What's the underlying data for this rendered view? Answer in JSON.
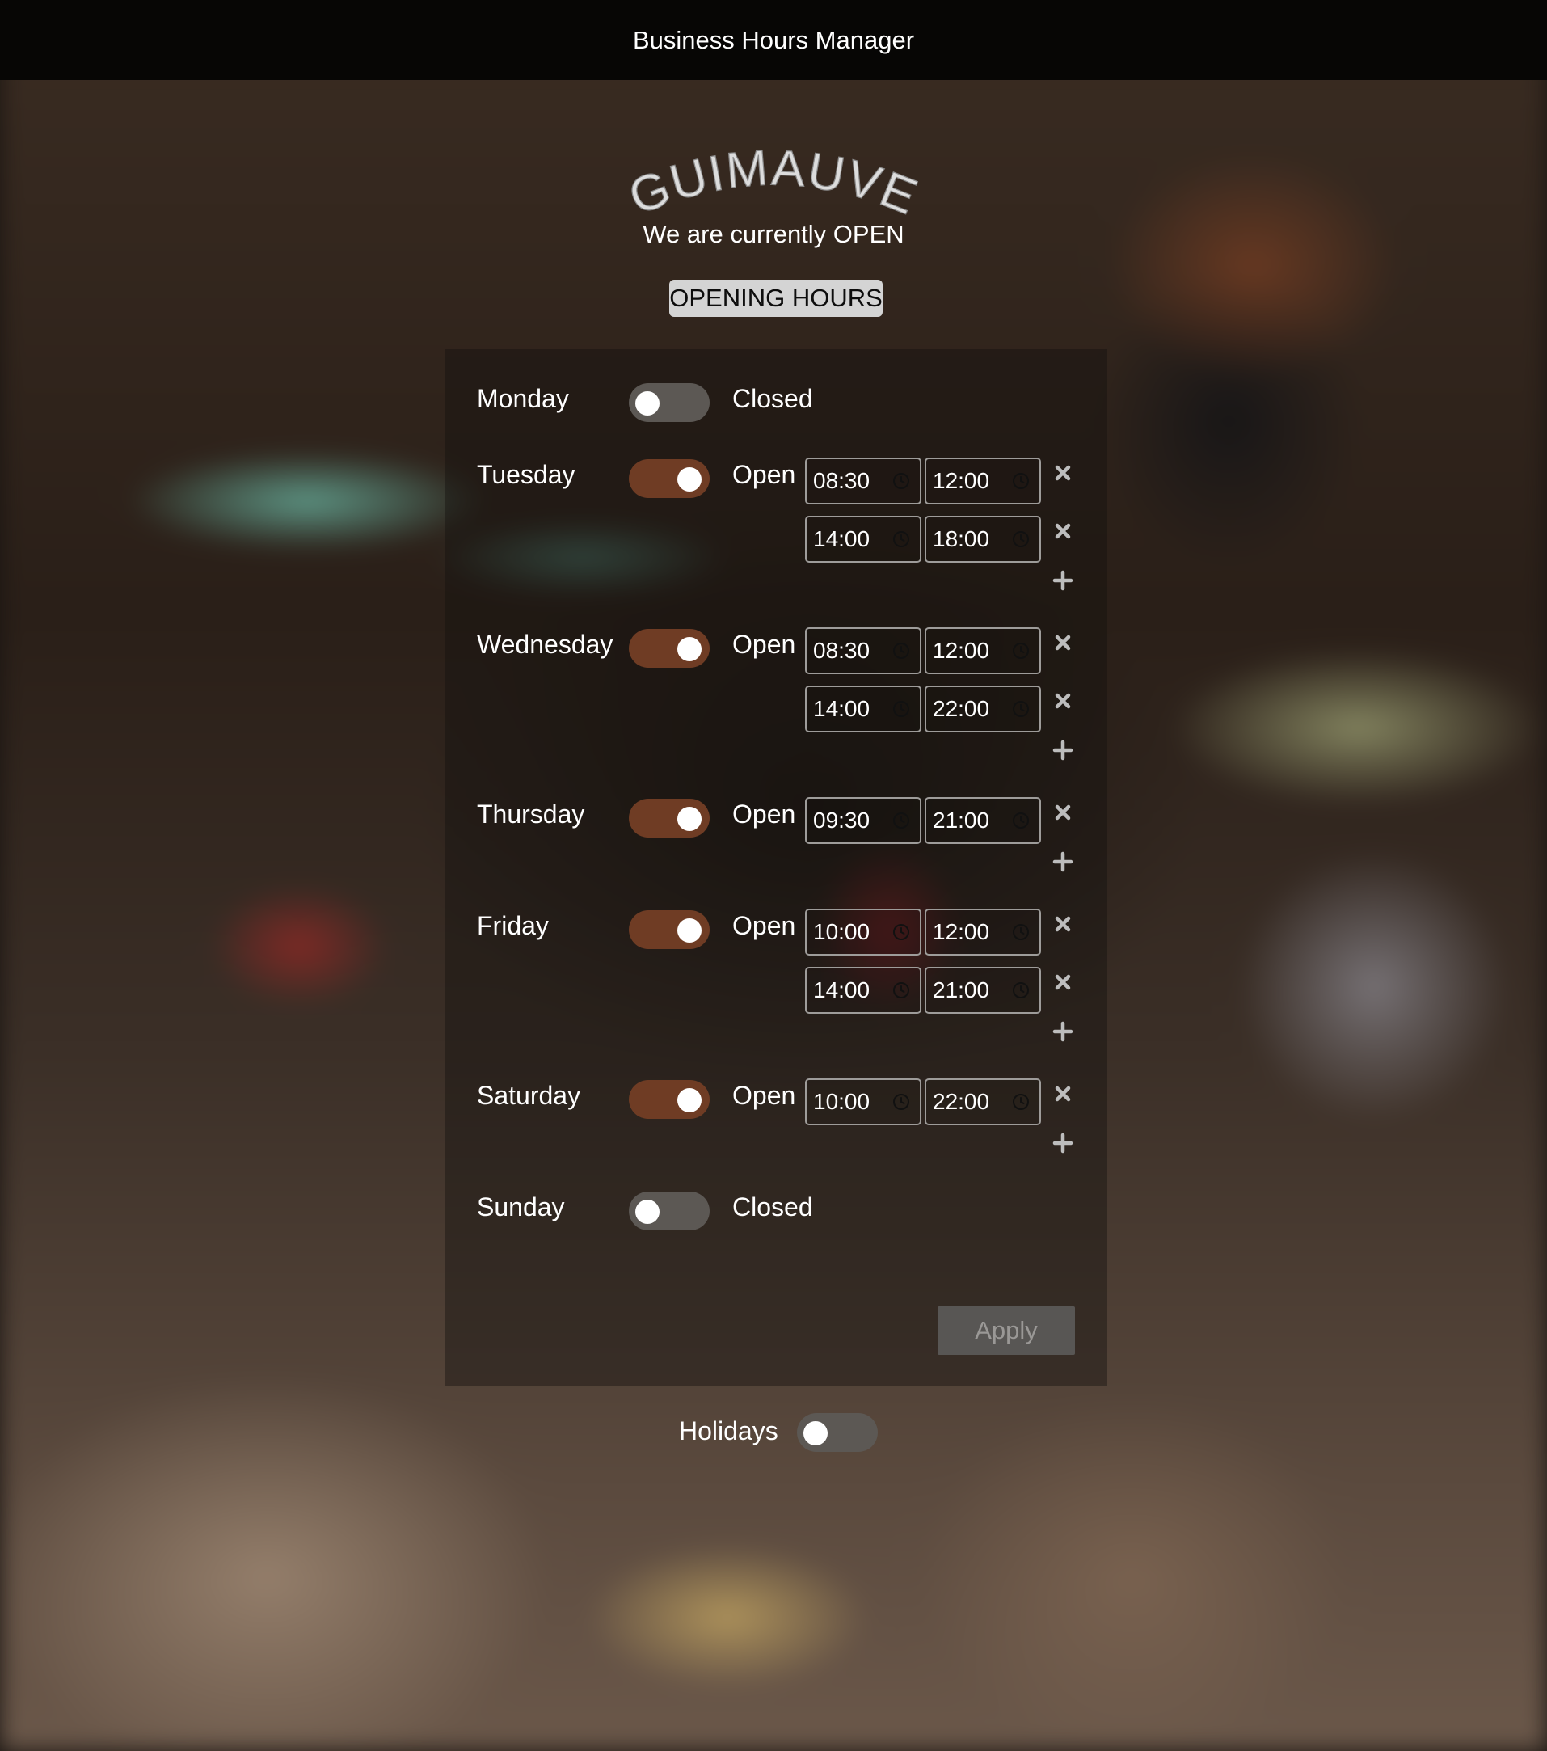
{
  "window": {
    "title": "Business Hours Manager"
  },
  "brand": {
    "name": "GUIMAUVE"
  },
  "status_text": "We are currently OPEN",
  "section_title": "OPENING HOURS",
  "days": [
    {
      "name": "Monday",
      "open": false,
      "state_label": "Closed",
      "slots": []
    },
    {
      "name": "Tuesday",
      "open": true,
      "state_label": "Open",
      "slots": [
        {
          "start": "08:30",
          "end": "12:00"
        },
        {
          "start": "14:00",
          "end": "18:00"
        }
      ]
    },
    {
      "name": "Wednesday",
      "open": true,
      "state_label": "Open",
      "slots": [
        {
          "start": "08:30",
          "end": "12:00"
        },
        {
          "start": "14:00",
          "end": "22:00"
        }
      ]
    },
    {
      "name": "Thursday",
      "open": true,
      "state_label": "Open",
      "slots": [
        {
          "start": "09:30",
          "end": "21:00"
        }
      ]
    },
    {
      "name": "Friday",
      "open": true,
      "state_label": "Open",
      "slots": [
        {
          "start": "10:00",
          "end": "12:00"
        },
        {
          "start": "14:00",
          "end": "21:00"
        }
      ]
    },
    {
      "name": "Saturday",
      "open": true,
      "state_label": "Open",
      "slots": [
        {
          "start": "10:00",
          "end": "22:00"
        }
      ]
    },
    {
      "name": "Sunday",
      "open": false,
      "state_label": "Closed",
      "slots": []
    }
  ],
  "actions": {
    "apply_label": "Apply"
  },
  "holidays": {
    "label": "Holidays",
    "enabled": false
  },
  "icons": {
    "remove": "close-icon",
    "add": "plus-icon",
    "clock": "clock-icon"
  },
  "colors": {
    "toggle_on": "#6f3c24",
    "toggle_off": "#5c5854",
    "top_bar": "#070605",
    "badge": "#d4d4d4"
  }
}
